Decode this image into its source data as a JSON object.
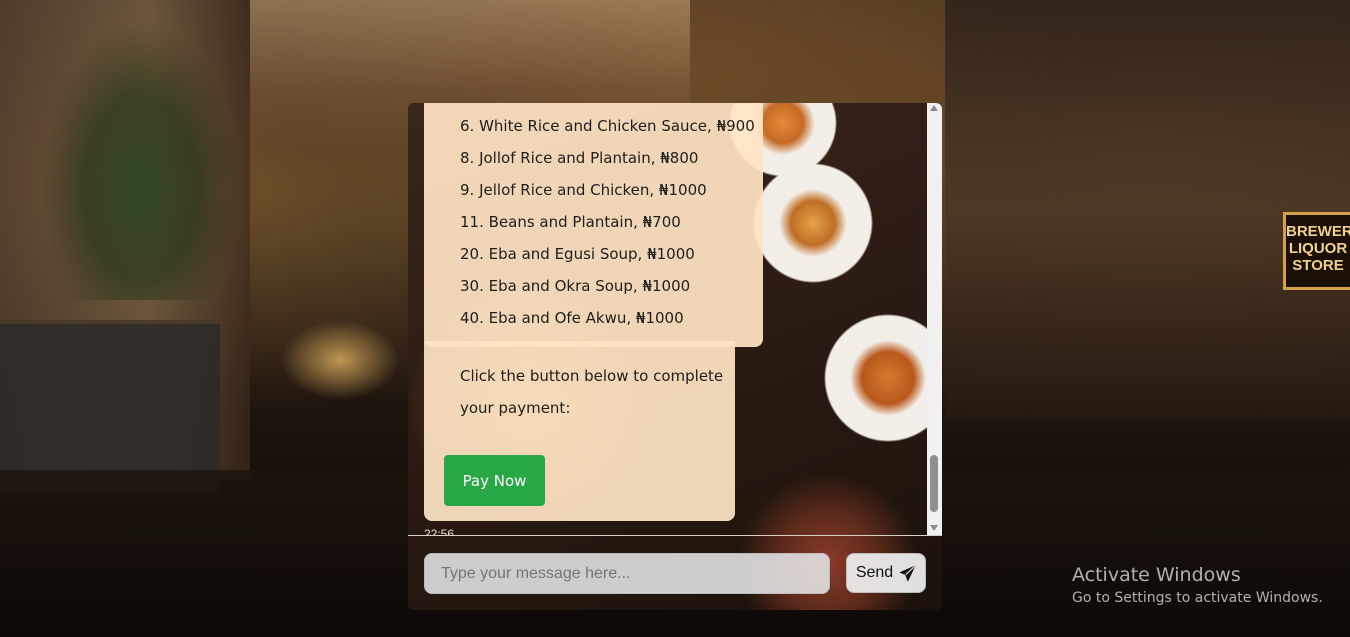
{
  "background": {
    "sign_text": "BREWERY LIQUOR STORE"
  },
  "chat": {
    "menu_items": [
      "6. White Rice and Chicken Sauce, ₦900",
      "8. Jollof Rice and Plantain, ₦800",
      "9. Jellof Rice and Chicken, ₦1000",
      "11. Beans and Plantain, ₦700",
      "20. Eba and Egusi Soup, ₦1000",
      "30. Eba and Okra Soup, ₦1000",
      "40. Eba and Ofe Akwu, ₦1000"
    ],
    "payment_prompt_line1": "Click the button below to complete",
    "payment_prompt_line2": "your payment:",
    "pay_button_label": "Pay Now",
    "timestamp": "22:56",
    "input_placeholder": "Type your message here...",
    "input_value": "",
    "send_label": "Send",
    "send_icon": "paper-plane-icon",
    "pay_button_color": "#28a745"
  },
  "windows_watermark": {
    "title": "Activate Windows",
    "subtitle": "Go to Settings to activate Windows."
  }
}
